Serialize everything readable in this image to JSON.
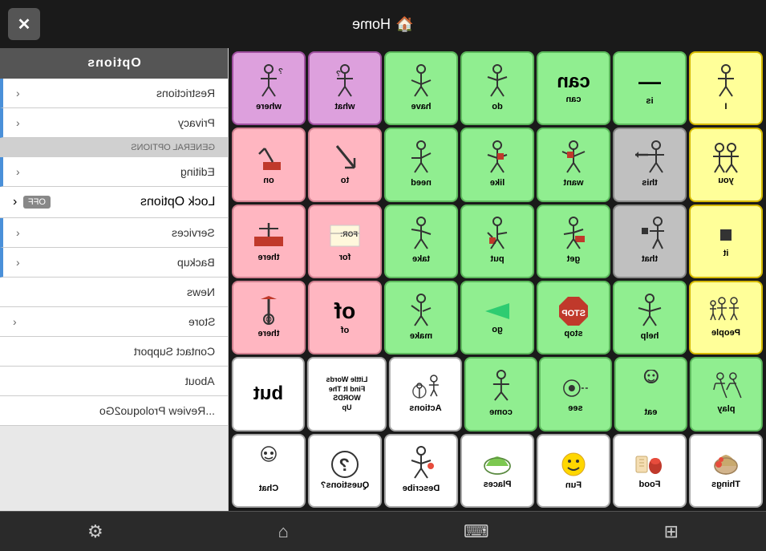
{
  "topBar": {
    "closeLabel": "✕",
    "homeLabel": "Home",
    "homeIcon": "🏠"
  },
  "sidebar": {
    "header": "Options",
    "items": [
      {
        "id": "restrictions",
        "label": "Restrictions",
        "hasChevron": true,
        "style": "blue"
      },
      {
        "id": "privacy",
        "label": "Privacy",
        "hasChevron": true,
        "style": "blue"
      },
      {
        "id": "general-options-header",
        "label": "GENERAL OPTIONS",
        "style": "section"
      },
      {
        "id": "editing",
        "label": "Editing",
        "hasChevron": true,
        "style": "blue"
      },
      {
        "id": "lock-options",
        "label": "Lock Options",
        "hasOff": true,
        "style": "off"
      },
      {
        "id": "services",
        "label": "Services",
        "hasChevron": true,
        "style": "blue"
      },
      {
        "id": "backup",
        "label": "Backup",
        "hasChevron": true,
        "style": "blue"
      },
      {
        "id": "news",
        "label": "News",
        "style": "plain"
      },
      {
        "id": "store",
        "label": "Store",
        "hasChevron": true,
        "style": "plain"
      },
      {
        "id": "contact-support",
        "label": "Contact Support",
        "style": "plain"
      },
      {
        "id": "about",
        "label": "About",
        "style": "plain"
      },
      {
        "id": "review",
        "label": "Review Proloquo2Go...",
        "style": "plain"
      }
    ]
  },
  "grid": {
    "rows": [
      {
        "cells": [
          {
            "id": "where",
            "label": "where",
            "color": "purple",
            "icon": "🤔"
          },
          {
            "id": "what",
            "label": "what",
            "color": "purple",
            "icon": "🙋"
          },
          {
            "id": "have",
            "label": "have",
            "color": "green",
            "icon": "👐"
          },
          {
            "id": "do",
            "label": "do",
            "color": "green",
            "icon": "👈"
          },
          {
            "id": "can",
            "label": "can",
            "color": "green",
            "textLarge": "can"
          },
          {
            "id": "is",
            "label": "is",
            "color": "green",
            "textLarge": "—"
          },
          {
            "id": "i",
            "label": "I",
            "color": "yellow",
            "icon": "👤"
          }
        ]
      },
      {
        "cells": [
          {
            "id": "on",
            "label": "on",
            "color": "pink",
            "icon": "📐"
          },
          {
            "id": "to",
            "label": "to",
            "color": "pink",
            "icon": "↙"
          },
          {
            "id": "need",
            "label": "need",
            "color": "green",
            "icon": "🤲"
          },
          {
            "id": "like",
            "label": "like",
            "color": "green",
            "icon": "🤗"
          },
          {
            "id": "want",
            "label": "want",
            "color": "green",
            "icon": "🙌"
          },
          {
            "id": "this",
            "label": "this",
            "color": "gray-cell",
            "icon": "👉"
          },
          {
            "id": "you",
            "label": "you",
            "color": "yellow",
            "icon": "👥"
          }
        ]
      },
      {
        "cells": [
          {
            "id": "there",
            "label": "there",
            "color": "pink",
            "icon": "🗺"
          },
          {
            "id": "for",
            "label": "for",
            "color": "pink",
            "icon": "🎫"
          },
          {
            "id": "take",
            "label": "take",
            "color": "green",
            "icon": "🖐"
          },
          {
            "id": "put",
            "label": "put",
            "color": "green",
            "icon": "📦"
          },
          {
            "id": "get",
            "label": "get",
            "color": "green",
            "icon": "📥"
          },
          {
            "id": "that",
            "label": "that",
            "color": "gray-cell",
            "icon": "👈"
          },
          {
            "id": "it",
            "label": "it",
            "color": "yellow",
            "icon": "◼"
          }
        ]
      },
      {
        "cells": [
          {
            "id": "there2",
            "label": "there",
            "color": "pink",
            "icon": "🚩"
          },
          {
            "id": "of",
            "label": "of",
            "color": "pink",
            "textXLarge": "of"
          },
          {
            "id": "make",
            "label": "make",
            "color": "green",
            "icon": "🔨"
          },
          {
            "id": "go",
            "label": "go",
            "color": "green",
            "icon": "⬅"
          },
          {
            "id": "stop",
            "label": "stop",
            "color": "green",
            "icon": "🛑"
          },
          {
            "id": "help",
            "label": "help",
            "color": "green",
            "icon": "🤝"
          },
          {
            "id": "people",
            "label": "People",
            "color": "yellow",
            "icon": "👨‍👩‍👧"
          }
        ]
      },
      {
        "cells": [
          {
            "id": "but",
            "label": "but",
            "color": "white-cell",
            "textXLarge": "but"
          },
          {
            "id": "little-words",
            "label": "Little Words\nFind It\nWORDS\nUp",
            "color": "white-cell",
            "icon": "📚"
          },
          {
            "id": "actions",
            "label": "Actions",
            "color": "white-cell",
            "icon": "🚴"
          },
          {
            "id": "come",
            "label": "come",
            "color": "green",
            "icon": "🙂"
          },
          {
            "id": "see",
            "label": "see",
            "color": "green",
            "icon": "👁"
          },
          {
            "id": "eat",
            "label": "eat",
            "color": "green",
            "icon": "🍽"
          },
          {
            "id": "play",
            "label": "play",
            "color": "green",
            "icon": "🏃"
          }
        ]
      },
      {
        "cells": [
          {
            "id": "chat",
            "label": "Chat",
            "color": "white-cell",
            "icon": "😊"
          },
          {
            "id": "questions",
            "label": "Questions?",
            "color": "white-cell",
            "icon": "❓"
          },
          {
            "id": "describe",
            "label": "Describe",
            "color": "white-cell",
            "icon": "🙆"
          },
          {
            "id": "places",
            "label": "Places",
            "color": "white-cell",
            "icon": "🗺"
          },
          {
            "id": "fun",
            "label": "Fun",
            "color": "white-cell",
            "icon": "🎉"
          },
          {
            "id": "food",
            "label": "Food",
            "color": "white-cell",
            "icon": "🥩"
          },
          {
            "id": "things",
            "label": "Things",
            "color": "white-cell",
            "icon": "🧺"
          }
        ]
      }
    ]
  },
  "bottomBar": {
    "settingsIcon": "⚙",
    "homeIcon": "⌂",
    "keyboardIcon": "⌨",
    "gridIcon": "⊞"
  }
}
